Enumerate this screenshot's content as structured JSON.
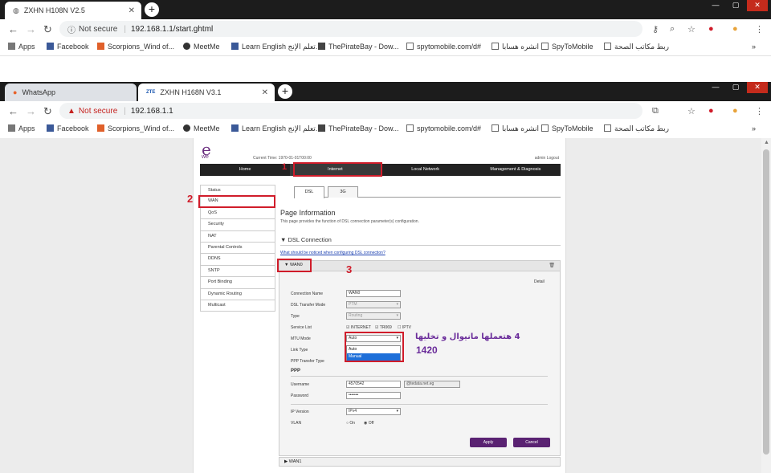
{
  "back_window": {
    "tab_title": "ZXHN H108N V2.5",
    "security": "Not secure",
    "url": "192.168.1.1/start.ghtml"
  },
  "front_window": {
    "tabs": [
      {
        "title": "WhatsApp"
      },
      {
        "title": "ZXHN H168N V3.1"
      }
    ],
    "security": "Not secure",
    "url": "192.168.1.1"
  },
  "bookmarks": [
    {
      "label": "Apps",
      "color": "#555"
    },
    {
      "label": "Facebook",
      "color": "#3b5998"
    },
    {
      "label": "Scorpions_Wind of...",
      "color": "#e0602a"
    },
    {
      "label": "MeetMe",
      "color": "#222"
    },
    {
      "label": "Learn English تعلم الإنج...",
      "color": "#3b5998"
    },
    {
      "label": "ThePirateBay - Dow...",
      "color": "#333"
    },
    {
      "label": "spytomobile.com/d#",
      "color": "#333"
    },
    {
      "label": "انشره هسابا",
      "color": "#333"
    },
    {
      "label": "SpyToMobile",
      "color": "#333"
    },
    {
      "label": "ربط مكاتب الصحة",
      "color": "#333"
    }
  ],
  "router": {
    "logo": "e",
    "logo_sub": "we",
    "current_time": "Current Time: 1970-01-01T00:00",
    "user": "admin   Logout",
    "menu": [
      "Home",
      "Internet",
      "Local Network",
      "Management & Diagnosis"
    ],
    "sidebar": [
      "Status",
      "WAN",
      "QoS",
      "Security",
      "NAT",
      "Parental Controls",
      "DDNS",
      "SNTP",
      "Port Binding",
      "Dynamic Routing",
      "Multicast"
    ],
    "subtabs": [
      "DSL",
      "3G"
    ],
    "page_title": "Page Information",
    "page_desc": "This page provides the function of DSL connection parameter(s) configuration.",
    "section": "▼ DSL Connection",
    "notice_link": "What should be noticed when configuring DSL connection?",
    "wan_label": "▼ WAN0",
    "detail": "Detail",
    "fields": {
      "connection_name": {
        "label": "Connection Name",
        "value": "WAN0"
      },
      "dsl_mode": {
        "label": "DSL Transfer Mode",
        "value": "PTM"
      },
      "type": {
        "label": "Type",
        "value": "Routing"
      },
      "service_list": {
        "label": "Service List",
        "options": [
          "INTERNET",
          "TR069",
          "IPTV"
        ]
      },
      "mtu_mode": {
        "label": "MTU Mode",
        "value": "Auto",
        "options": [
          "Auto",
          "Manual"
        ],
        "selected": "Manual"
      },
      "link_type": {
        "label": "Link Type"
      },
      "ppp_transfer": {
        "label": "PPP Transfer Type"
      },
      "ppp_heading": "PPP",
      "username": {
        "label": "Username",
        "value": "4570542",
        "suffix": "@tedata.net.eg"
      },
      "password": {
        "label": "Password",
        "value": "•••••••"
      },
      "ip_version": {
        "label": "IP Version",
        "value": "IPv4"
      },
      "vlan": {
        "label": "VLAN",
        "on": "On",
        "off": "Off"
      }
    },
    "apply": "Apply",
    "cancel": "Cancel",
    "wan1": "▶ WAN1"
  },
  "annotations": {
    "n1": "1",
    "n2": "2",
    "n3": "3",
    "note_arabic": "4 هتعملها مانيوال و تخليها",
    "note_number": "1420",
    "color": "#d01c2a"
  }
}
